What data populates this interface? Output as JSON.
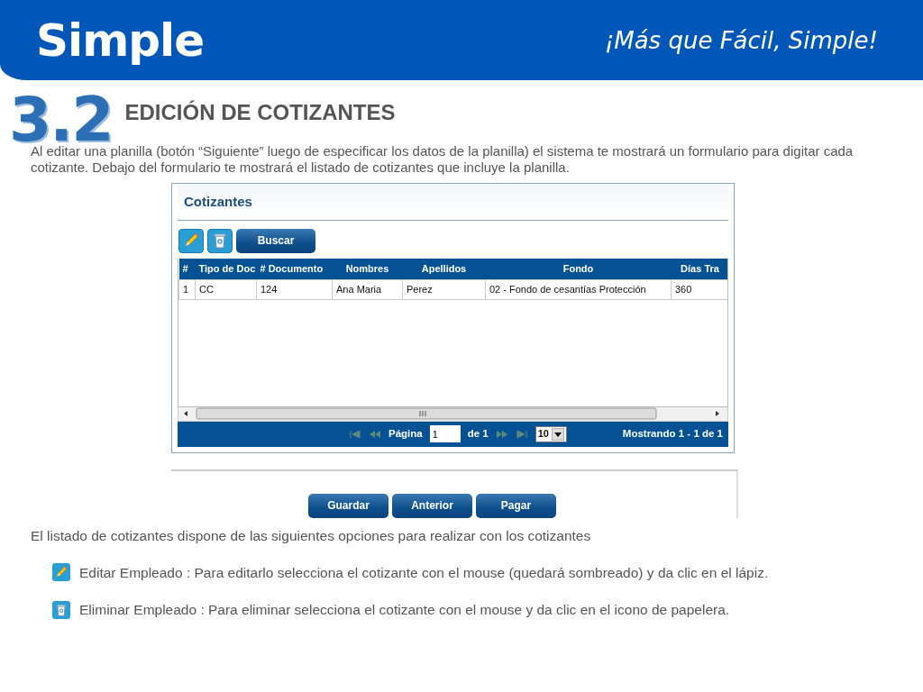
{
  "header": {
    "logo": "Simple",
    "tagline": "¡Más que Fácil, Simple!"
  },
  "section": {
    "number": "3.2",
    "title": "EDICIÓN DE COTIZANTES",
    "intro": "Al editar  una planilla (botón “Siguiente” luego de especificar los datos de la planilla) el sistema te  mostrará un formulario para digitar cada cotizante. Debajo del formulario te mostrará el listado de cotizantes que incluye la planilla."
  },
  "panel": {
    "title": "Cotizantes",
    "toolbar": [
      {
        "kind": "edit"
      },
      {
        "kind": "delete"
      },
      {
        "kind": "text",
        "label": "Buscar"
      }
    ],
    "table": {
      "columns": [
        "#",
        "Tipo de Doc",
        "# Documento",
        "Nombres",
        "Apellidos",
        "Fondo",
        "Días Tra"
      ],
      "rows": [
        [
          "1",
          "CC",
          "124",
          "Ana Maria",
          "Perez",
          "02 - Fondo de cesantías Protección",
          "360"
        ]
      ]
    },
    "pager": {
      "label": "Página",
      "page": "1",
      "of": "de 1",
      "page_size": "10",
      "summary": "Mostrando 1 - 1 de 1"
    }
  },
  "actions": [
    "Guardar",
    "Anterior",
    "Pagar"
  ],
  "options_intro": "El listado de cotizantes dispone de las siguientes opciones para realizar con los cotizantes",
  "options": [
    {
      "kind": "edit",
      "text": "Editar Empleado : Para editarlo selecciona el cotizante con el mouse (quedará sombreado) y da clic en el lápiz."
    },
    {
      "kind": "delete",
      "text": "Eliminar Empleado : Para eliminar selecciona el cotizante con el mouse y da clic en el icono de papelera."
    }
  ]
}
